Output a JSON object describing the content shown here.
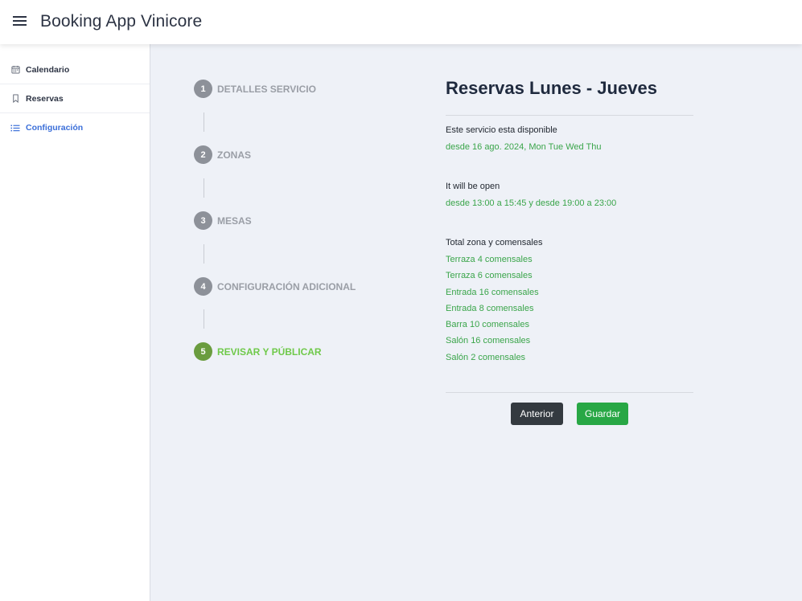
{
  "header": {
    "title": "Booking App Vinicore",
    "menu_icon": "hamburger-menu-icon"
  },
  "sidebar": {
    "items": [
      {
        "label": "Calendario",
        "icon": "calendar-icon",
        "active": false
      },
      {
        "label": "Reservas",
        "icon": "bookmark-icon",
        "active": false
      },
      {
        "label": "Configuración",
        "icon": "list-icon",
        "active": true
      }
    ]
  },
  "steps": [
    {
      "number": "1",
      "label": "DETALLES SERVICIO",
      "active": false
    },
    {
      "number": "2",
      "label": "ZONAS",
      "active": false
    },
    {
      "number": "3",
      "label": "MESAS",
      "active": false
    },
    {
      "number": "4",
      "label": "CONFIGURACIÓN ADICIONAL",
      "active": false
    },
    {
      "number": "5",
      "label": "REVISAR Y PÚBLICAR",
      "active": true
    }
  ],
  "review": {
    "title": "Reservas Lunes - Jueves",
    "availability_label": "Este servicio esta disponible",
    "availability_value": "desde 16 ago. 2024, Mon Tue Wed Thu",
    "open_label": "It will be open",
    "open_value": "desde 13:00 a 15:45 y desde 19:00 a 23:00",
    "zones_label": "Total zona y comensales",
    "zones": [
      "Terraza 4 comensales",
      "Terraza 6 comensales",
      "Entrada 16 comensales",
      "Entrada 8 comensales",
      "Barra 10 comensales",
      "Salón 16 comensales",
      "Salón 2 comensales"
    ]
  },
  "buttons": {
    "previous": "Anterior",
    "save": "Guardar"
  },
  "colors": {
    "accent_blue": "#3b6fd9",
    "success_green": "#28a745",
    "active_step_green": "#6a9c3f",
    "dark_button": "#343a40"
  }
}
